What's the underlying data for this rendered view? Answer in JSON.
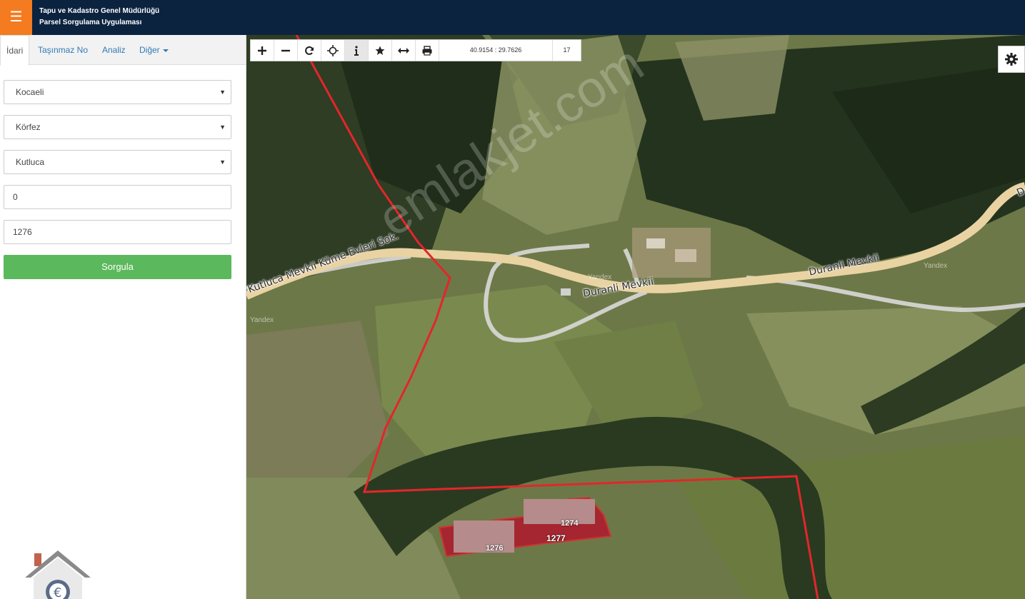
{
  "header": {
    "menu_icon": "hamburger-icon",
    "title_line1": "Tapu ve Kadastro Genel Müdürlüğü",
    "title_line2": "Parsel Sorgulama Uygulaması",
    "accent_color": "#f47b20",
    "bg_color": "#0c2340"
  },
  "tabs": [
    {
      "label": "İdari",
      "active": true
    },
    {
      "label": "Taşınmaz No",
      "active": false
    },
    {
      "label": "Analiz",
      "active": false
    },
    {
      "label": "Diğer",
      "active": false
    }
  ],
  "form": {
    "il": "Kocaeli",
    "ilce": "Körfez",
    "mahalle": "Kutluca",
    "ada": "0",
    "parsel": "1276",
    "submit_label": "Sorgula",
    "submit_color": "#5cb85c"
  },
  "toolbar": {
    "tools": [
      "zoom-in-icon",
      "zoom-out-icon",
      "refresh-icon",
      "locate-icon",
      "info-icon",
      "star-icon",
      "measure-icon",
      "print-icon"
    ],
    "active_tool": "info-icon",
    "coordinates": "40.9154 : 29.7626",
    "zoom_level": "17"
  },
  "map": {
    "road_labels": [
      "Kutluca Mevkii Küme Evleri Sok.",
      "Duranli Mevkii",
      "Duranli Mevkii",
      "D"
    ],
    "attribution": [
      "Yandex",
      "Yandex",
      "Yandex"
    ],
    "watermark": "emlakjet.com",
    "parcel_labels": [
      "1277",
      "1276",
      "1274"
    ],
    "boundary_color": "#e3262b",
    "parcel_fill": "#b3122b"
  },
  "settings_icon": "gear-icon",
  "logo_icon": "house-logo-icon"
}
